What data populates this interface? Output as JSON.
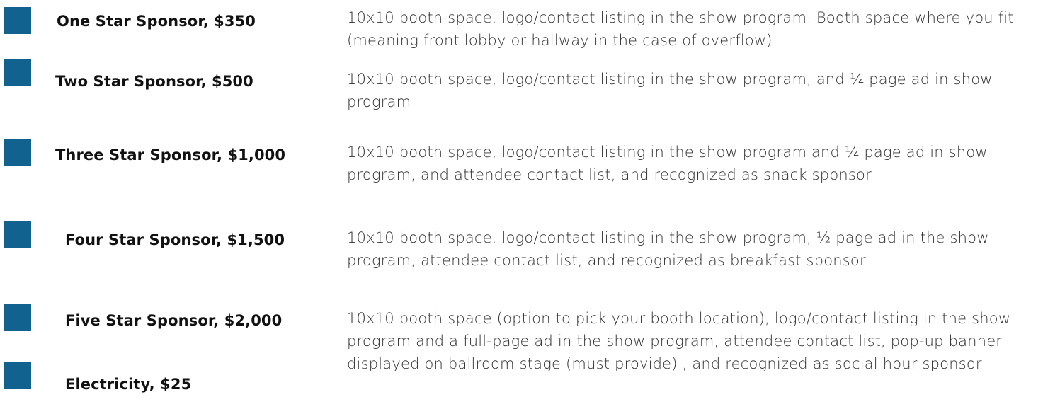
{
  "brand": {
    "checkbox_color": "#12628f"
  },
  "tiers": [
    {
      "label": "One Star Sponsor, $350",
      "description": "10x10 booth space, logo/contact listing in the show program. Booth space where you fit (meaning front lobby or hallway in the case of overflow)"
    },
    {
      "label": "Two Star Sponsor, $500",
      "description": "10x10 booth space, logo/contact listing in the show program, and ¼ page ad in show program"
    },
    {
      "label": "Three Star Sponsor, $1,000",
      "description": "10x10 booth space, logo/contact listing in the show program and ¼ page ad in show program, and attendee contact list,  and recognized as snack sponsor"
    },
    {
      "label": "Four Star Sponsor, $1,500",
      "description": "10x10 booth space, logo/contact listing in the show program, ½ page ad in the show program, attendee contact list, and recognized as breakfast sponsor"
    },
    {
      "label": "Five Star Sponsor, $2,000",
      "description": "10x10 booth space (option to pick your booth location), logo/contact listing in the show program and a full-page ad in the show program, attendee contact list, pop-up banner displayed on ballroom stage (must provide) , and recognized as social hour sponsor"
    },
    {
      "label": "Electricity, $25",
      "description": ""
    }
  ]
}
